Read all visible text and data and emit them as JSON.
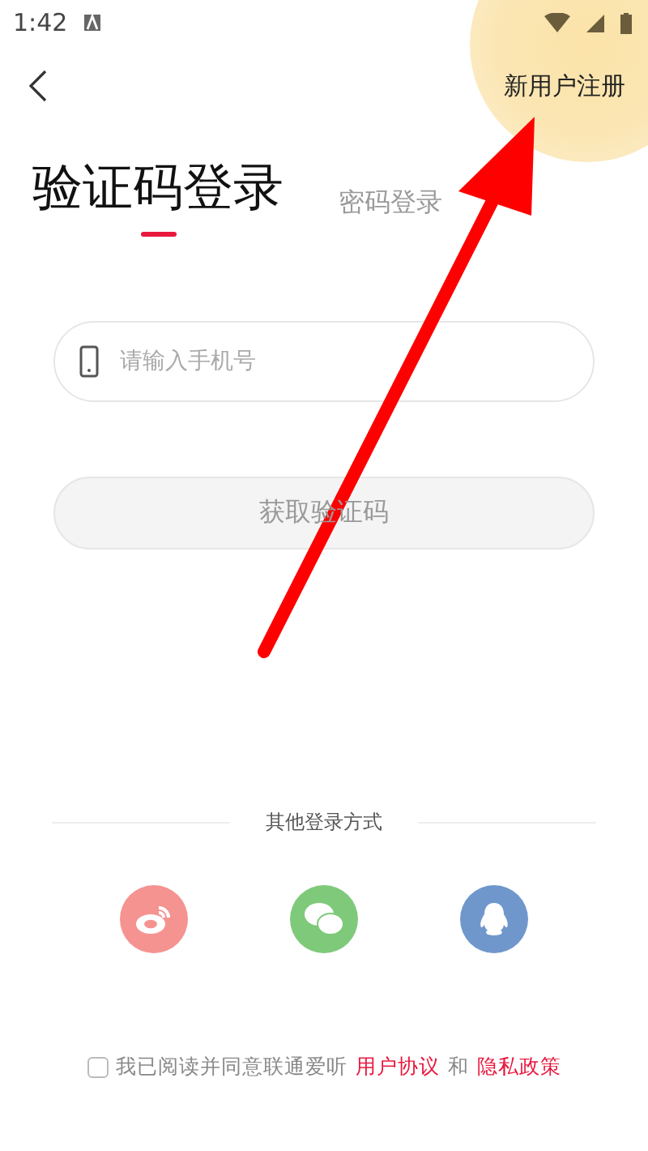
{
  "status_bar": {
    "time": "1:42"
  },
  "header": {
    "register_link": "新用户注册",
    "highlighted": true
  },
  "tabs": [
    {
      "label": "验证码登录",
      "selected": true
    },
    {
      "label": "密码登录",
      "selected": false
    }
  ],
  "phone_field": {
    "placeholder": "请输入手机号"
  },
  "get_code_button": {
    "label": "获取验证码",
    "disabled": true
  },
  "other_login": {
    "title": "其他登录方式",
    "methods": [
      {
        "kind": "weibo",
        "color": "#f59391"
      },
      {
        "kind": "wechat",
        "color": "#7fc97b"
      },
      {
        "kind": "qq",
        "color": "#7097cc"
      }
    ]
  },
  "agreement": {
    "checked": false,
    "text": "我已阅读并同意联通爱听",
    "link_1": "用户协议",
    "joiner": "和",
    "link_2": "隐私政策"
  },
  "annotation": {
    "kind": "arrow"
  }
}
